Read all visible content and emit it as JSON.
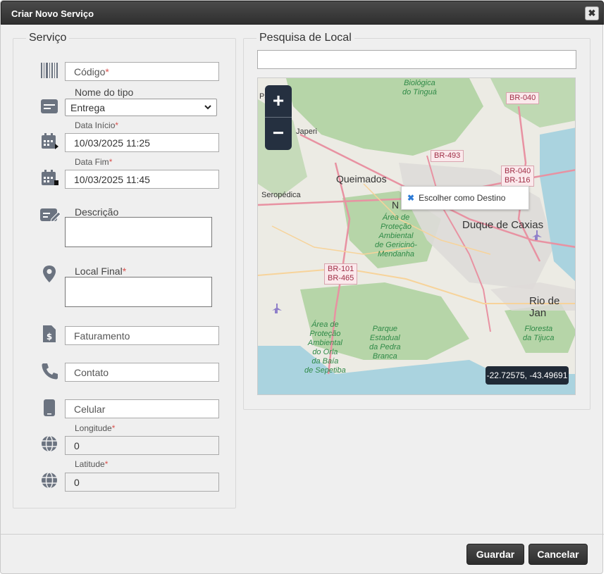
{
  "dialog": {
    "title": "Criar Novo Serviço",
    "close_glyph": "✖"
  },
  "servico": {
    "legend": "Serviço",
    "codigo": {
      "placeholder": "Código",
      "required": "*"
    },
    "nome_tipo": {
      "label": "Nome do tipo",
      "value": "Entrega"
    },
    "data_inicio": {
      "label": "Data Início",
      "required": "*",
      "value": "10/03/2025 11:25"
    },
    "data_fim": {
      "label": "Data Fim",
      "required": "*",
      "value": "10/03/2025 11:45"
    },
    "descricao": {
      "label": "Descrição"
    },
    "local_final": {
      "label": "Local Final",
      "required": "*"
    },
    "faturamento": {
      "placeholder": "Faturamento"
    },
    "contato": {
      "placeholder": "Contato"
    },
    "celular": {
      "placeholder": "Celular"
    },
    "longitude": {
      "label": "Longitude",
      "required": "*",
      "value": "0"
    },
    "latitude": {
      "label": "Latitude",
      "required": "*",
      "value": "0"
    }
  },
  "pesquisa": {
    "legend": "Pesquisa de Local",
    "search_value": ""
  },
  "map": {
    "zoom_in": "+",
    "zoom_out": "−",
    "popup_text": "Escolher como Destino",
    "coords": "-22.72575, -43.49691",
    "places": {
      "queimados": "Queimados",
      "japeri": "Japeri",
      "seropedica": "Seropédica",
      "duque": "Duque de Caxias",
      "rio": "Rio de Jan",
      "ni": "N",
      "pa": "Pa"
    },
    "roads": {
      "br040a": "BR-040",
      "br493": "BR-493",
      "br040b": "BR-040",
      "br116": "BR-116",
      "br101": "BR-101",
      "br465": "BR-465"
    },
    "parks": {
      "tingua": [
        "Biológica",
        "do Tinguá"
      ],
      "gericino": [
        "Área de",
        "Proteção",
        "Ambiental",
        "de Gericinó-",
        "Mendanha"
      ],
      "sepetiba": [
        "Área de",
        "Proteção",
        "Ambiental",
        "do Orla",
        "da Baía",
        "de Sepetiba"
      ],
      "pedra": [
        "Parque",
        "Estadual",
        "da Pedra",
        "Branca"
      ],
      "tijuca": [
        "Floresta",
        "da Tijuca"
      ]
    },
    "colors": {
      "water": "#aad3df",
      "forest": "#add19e",
      "urban": "#e0dfdf",
      "road": "#e892a2",
      "road_minor": "#f7d39a"
    }
  },
  "footer": {
    "save_label": "Guardar",
    "cancel_label": "Cancelar"
  }
}
